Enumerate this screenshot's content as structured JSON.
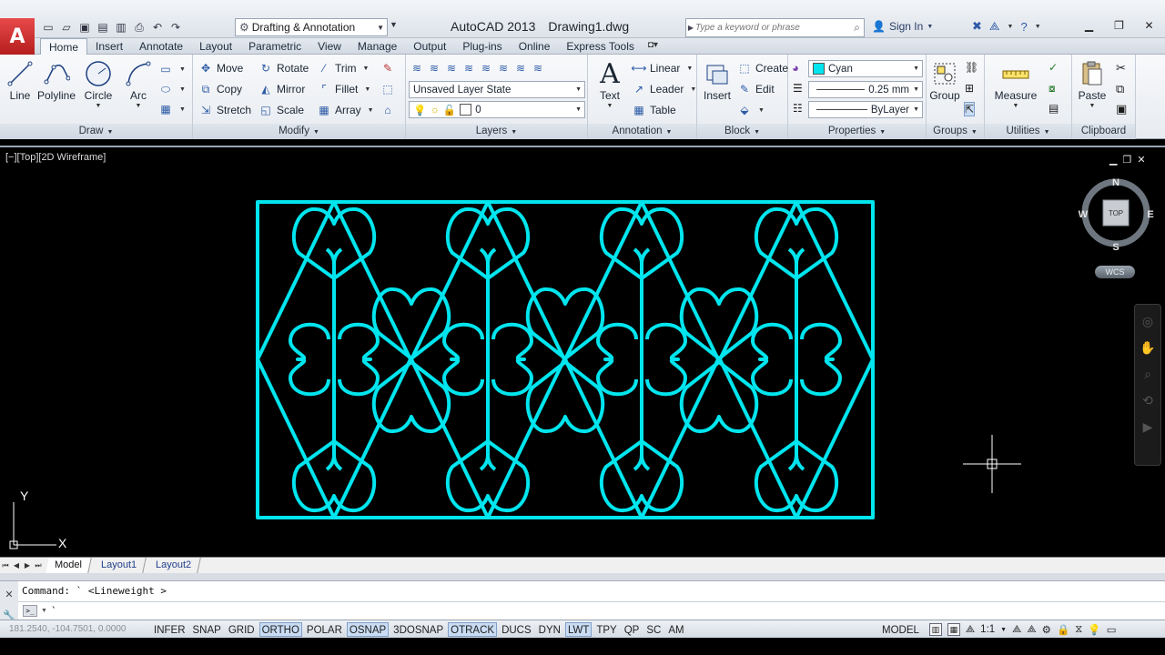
{
  "title_bar": {
    "app": "AutoCAD 2013",
    "document": "Drawing1.dwg",
    "workspace": "Drafting & Annotation",
    "search_placeholder": "Type a keyword or phrase",
    "sign_in": "Sign In"
  },
  "ribbon_tabs": [
    "Home",
    "Insert",
    "Annotate",
    "Layout",
    "Parametric",
    "View",
    "Manage",
    "Output",
    "Plug-ins",
    "Online",
    "Express Tools"
  ],
  "active_tab": "Home",
  "panels": {
    "draw": {
      "title": "Draw",
      "tools": [
        "Line",
        "Polyline",
        "Circle",
        "Arc"
      ]
    },
    "modify": {
      "title": "Modify",
      "tools": [
        "Move",
        "Rotate",
        "Trim",
        "Copy",
        "Mirror",
        "Fillet",
        "Stretch",
        "Scale",
        "Array"
      ]
    },
    "layers": {
      "title": "Layers",
      "layer_state": "Unsaved Layer State",
      "current_layer": "0"
    },
    "annotation": {
      "title": "Annotation",
      "text": "Text",
      "tools": [
        "Linear",
        "Leader",
        "Table"
      ]
    },
    "block": {
      "title": "Block",
      "insert": "Insert",
      "tools": [
        "Create",
        "Edit"
      ]
    },
    "properties": {
      "title": "Properties",
      "color": "Cyan",
      "lineweight": "0.25 mm",
      "linetype": "ByLayer"
    },
    "groups": {
      "title": "Groups",
      "tool": "Group"
    },
    "utilities": {
      "title": "Utilities",
      "tool": "Measure"
    },
    "clipboard": {
      "title": "Clipboard",
      "tool": "Paste"
    }
  },
  "viewport": {
    "label": "[−][Top][2D Wireframe]",
    "viewcube": {
      "face": "TOP",
      "north": "N",
      "south": "S",
      "east": "E",
      "west": "W"
    },
    "wcs": "WCS",
    "ucs_x": "X",
    "ucs_y": "Y"
  },
  "drawing": {
    "color": "#00e5ee"
  },
  "layout_tabs": [
    "Model",
    "Layout1",
    "Layout2"
  ],
  "active_layout": "Model",
  "command_line": {
    "history": "Command: ` <Lineweight >",
    "input": "`"
  },
  "status_bar": {
    "coords": "181.2540, -104.7501, 0.0000",
    "toggles": [
      {
        "label": "INFER",
        "on": false
      },
      {
        "label": "SNAP",
        "on": false
      },
      {
        "label": "GRID",
        "on": false
      },
      {
        "label": "ORTHO",
        "on": true
      },
      {
        "label": "POLAR",
        "on": false
      },
      {
        "label": "OSNAP",
        "on": true
      },
      {
        "label": "3DOSNAP",
        "on": false
      },
      {
        "label": "OTRACK",
        "on": true
      },
      {
        "label": "DUCS",
        "on": false
      },
      {
        "label": "DYN",
        "on": false
      },
      {
        "label": "LWT",
        "on": true
      },
      {
        "label": "TPY",
        "on": false
      },
      {
        "label": "QP",
        "on": false
      },
      {
        "label": "SC",
        "on": false
      },
      {
        "label": "AM",
        "on": false
      }
    ],
    "model": "MODEL",
    "annotation_scale": "1:1"
  }
}
